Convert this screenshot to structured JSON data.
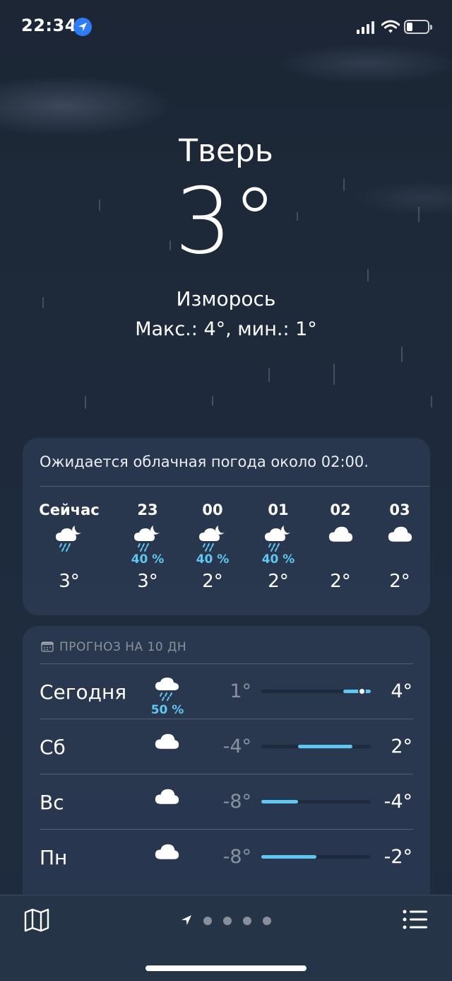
{
  "status_bar": {
    "time": "22:34",
    "icons": [
      "location-arrow-icon",
      "signal-icon",
      "wifi-icon",
      "battery-icon"
    ]
  },
  "weather": {
    "city": "Тверь",
    "temperature": "3°",
    "condition": "Изморось",
    "hi_lo": "Макс.: 4°, мин.: 1°"
  },
  "hourly": {
    "summary": "Ожидается облачная погода около 02:00.",
    "hours": [
      {
        "label": "Сейчас",
        "icon": "night-drizzle-icon",
        "precip": "",
        "temp": "3°"
      },
      {
        "label": "23",
        "icon": "night-drizzle-icon",
        "precip": "40 %",
        "temp": "3°"
      },
      {
        "label": "00",
        "icon": "night-drizzle-icon",
        "precip": "40 %",
        "temp": "2°"
      },
      {
        "label": "01",
        "icon": "night-drizzle-icon",
        "precip": "40 %",
        "temp": "2°"
      },
      {
        "label": "02",
        "icon": "cloud-icon",
        "precip": "",
        "temp": "2°"
      },
      {
        "label": "03",
        "icon": "cloud-icon",
        "precip": "",
        "temp": "2°"
      }
    ]
  },
  "daily": {
    "header": "ПРОГНОЗ НА 10 ДН",
    "range_min": -8,
    "range_max": 4,
    "days": [
      {
        "name": "Сегодня",
        "icon": "drizzle-icon",
        "precip": "50 %",
        "low": "1°",
        "high": "4°",
        "low_val": 1,
        "high_val": 4,
        "current": 3
      },
      {
        "name": "Сб",
        "icon": "cloud-icon",
        "precip": "",
        "low": "-4°",
        "high": "2°",
        "low_val": -4,
        "high_val": 2
      },
      {
        "name": "Вс",
        "icon": "cloud-icon",
        "precip": "",
        "low": "-8°",
        "high": "-4°",
        "low_val": -8,
        "high_val": -4
      },
      {
        "name": "Пн",
        "icon": "cloud-icon",
        "precip": "",
        "low": "-8°",
        "high": "-2°",
        "low_val": -8,
        "high_val": -2
      }
    ]
  },
  "bottom_bar": {
    "pages": 4,
    "icons": [
      "map-icon",
      "location-page-icon",
      "list-icon"
    ]
  },
  "colors": {
    "accent_blue": "#5ec8f2",
    "location_badge": "#2e7cf6"
  }
}
